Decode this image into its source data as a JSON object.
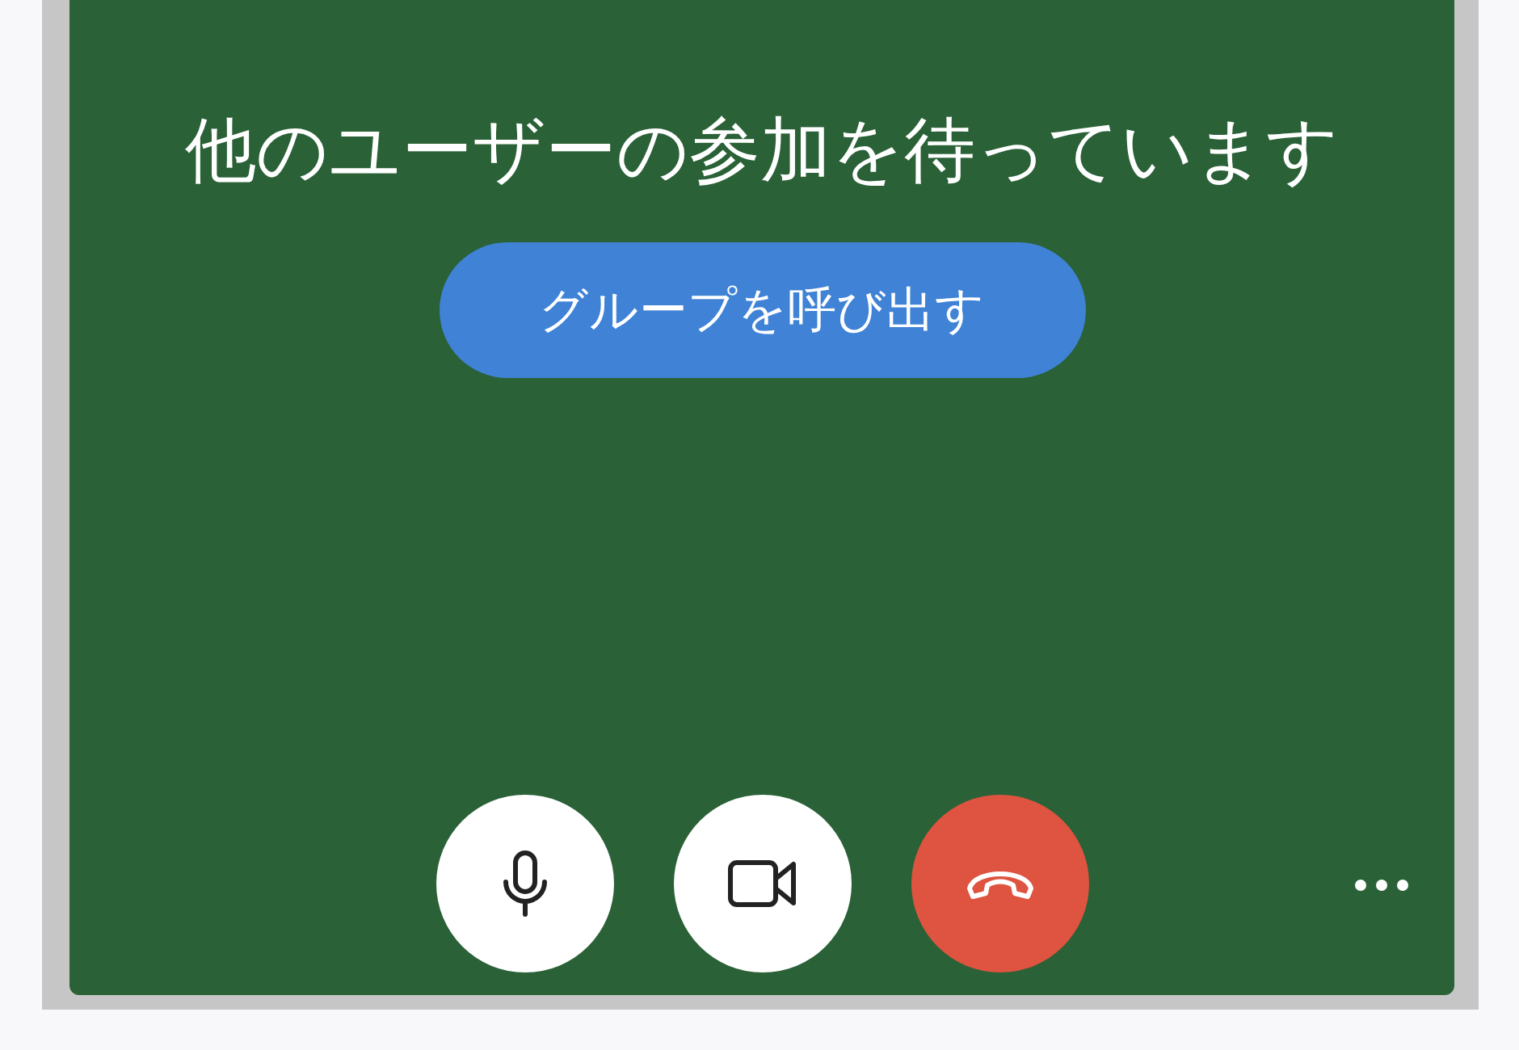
{
  "status_message": "他のユーザーの参加を待っています",
  "call_group_button": {
    "label": "グループを呼び出す"
  },
  "controls": [
    {
      "kind": "microphone"
    },
    {
      "kind": "camera"
    },
    {
      "kind": "hangup"
    }
  ],
  "more_menu": {
    "kind": "dots"
  }
}
